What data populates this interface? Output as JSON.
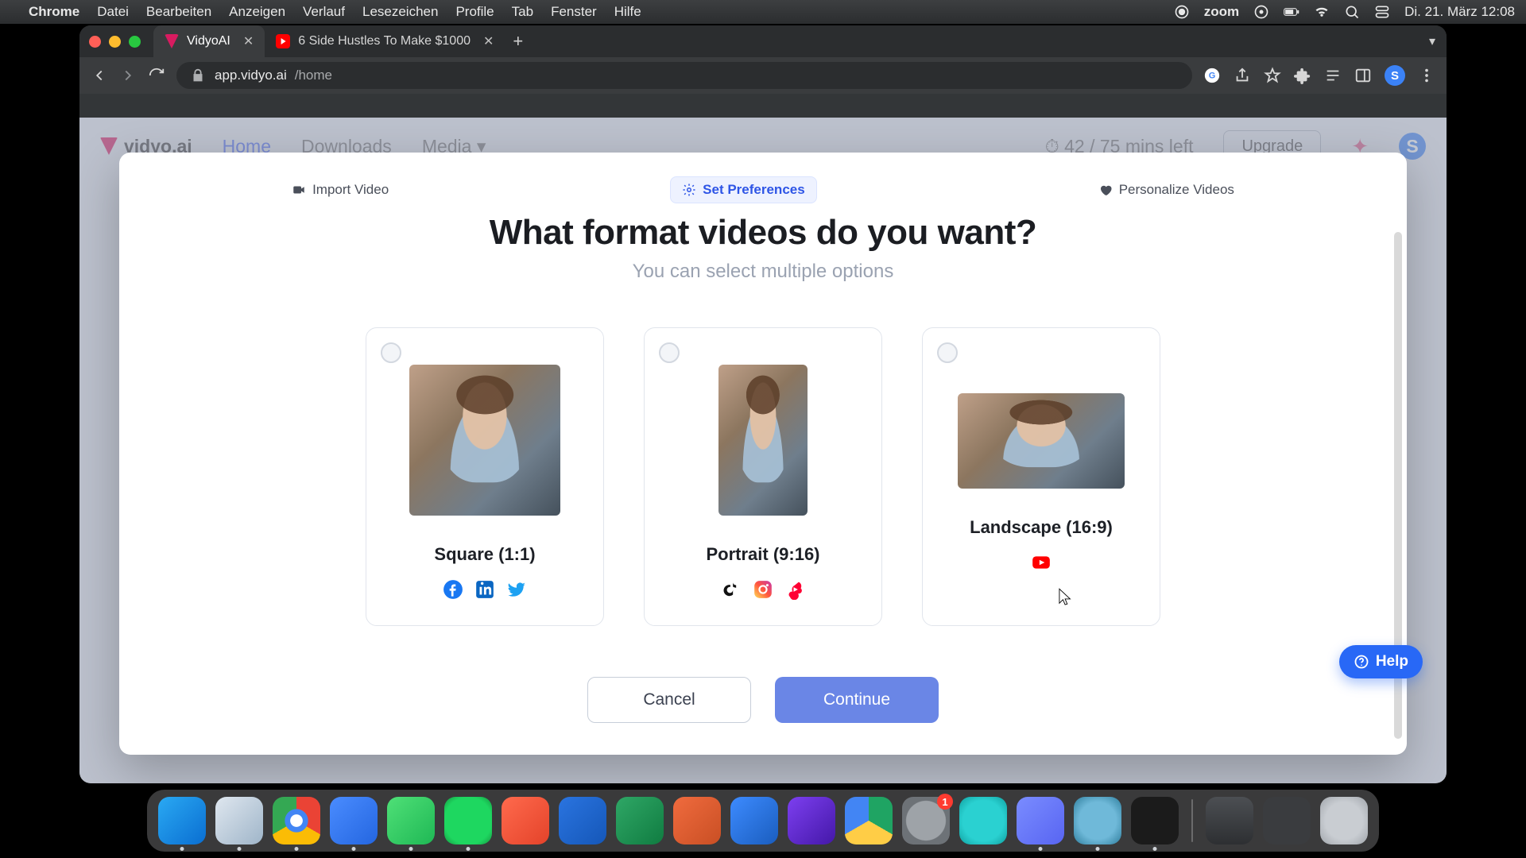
{
  "menubar": {
    "app": "Chrome",
    "items": [
      "Datei",
      "Bearbeiten",
      "Anzeigen",
      "Verlauf",
      "Lesezeichen",
      "Profile",
      "Tab",
      "Fenster",
      "Hilfe"
    ],
    "zoom": "zoom",
    "datetime": "Di. 21. März  12:08"
  },
  "tabs": [
    {
      "title": "VidyoAI",
      "active": true
    },
    {
      "title": "6 Side Hustles To Make $1000",
      "active": false
    }
  ],
  "address": {
    "host": "app.vidyo.ai",
    "path": "/home"
  },
  "toolbar": {
    "avatar_initial": "S"
  },
  "background_header": {
    "brand": "vidyo.ai",
    "nav": {
      "home": "Home",
      "downloads": "Downloads",
      "media": "Media"
    },
    "mins_left": "42 / 75 mins left",
    "upgrade": "Upgrade",
    "avatar_initial": "S"
  },
  "modal": {
    "steps": [
      {
        "label": "Import Video",
        "active": false
      },
      {
        "label": "Set Preferences",
        "active": true
      },
      {
        "label": "Personalize Videos",
        "active": false
      }
    ],
    "title": "What format videos do you want?",
    "subtitle": "You can select multiple options",
    "cards": [
      {
        "label": "Square (1:1)",
        "thumb": "sq",
        "socials": [
          "facebook",
          "linkedin",
          "twitter"
        ]
      },
      {
        "label": "Portrait (9:16)",
        "thumb": "pt",
        "socials": [
          "tiktok",
          "instagram",
          "ytshorts"
        ]
      },
      {
        "label": "Landscape (16:9)",
        "thumb": "ls",
        "socials": [
          "youtube"
        ]
      }
    ],
    "buttons": {
      "cancel": "Cancel",
      "continue": "Continue"
    },
    "help": "Help"
  },
  "dock": {
    "apps": [
      {
        "name": "finder",
        "bg": "linear-gradient(135deg,#2aa9f3,#0a6ed1)",
        "running": true
      },
      {
        "name": "safari",
        "bg": "linear-gradient(135deg,#dfe7ef,#9fb5c9)",
        "running": true
      },
      {
        "name": "chrome",
        "bg": "radial-gradient(circle at 50% 50%, #fff 0 18%, #4285f4 19% 34%, transparent 35%), conic-gradient(#ea4335 0 120deg,#fbbc05 120deg 240deg,#34a853 240deg 360deg)",
        "running": true
      },
      {
        "name": "zoom",
        "bg": "linear-gradient(135deg,#4a8cff,#2466e0)",
        "running": true
      },
      {
        "name": "whatsapp",
        "bg": "linear-gradient(135deg,#4fe077,#1fb855)",
        "running": true
      },
      {
        "name": "spotify",
        "bg": "radial-gradient(circle,#1ed760 0 70%, #14933f 100%)",
        "running": true
      },
      {
        "name": "todoist",
        "bg": "linear-gradient(135deg,#ff6a4d,#e4432a)",
        "running": false
      },
      {
        "name": "trello",
        "bg": "linear-gradient(135deg,#2a74e0,#1557b8)",
        "running": false
      },
      {
        "name": "excel",
        "bg": "linear-gradient(135deg,#2fa766,#107c41)",
        "running": false
      },
      {
        "name": "powerpoint",
        "bg": "linear-gradient(135deg,#f06b3e,#c94f24)",
        "running": false
      },
      {
        "name": "word",
        "bg": "linear-gradient(135deg,#3d8bff,#1a5dbe)",
        "running": false
      },
      {
        "name": "imovie",
        "bg": "linear-gradient(135deg,#7d3ff0,#4418a8)",
        "running": false
      },
      {
        "name": "drive",
        "bg": "conic-gradient(#1fa463 0 120deg,#ffcd46 120deg 240deg,#4285f4 240deg 360deg)",
        "running": false
      },
      {
        "name": "settings",
        "bg": "radial-gradient(circle,#9ea3a8 0 58%, #6d7277 60% 100%)",
        "running": false,
        "badge": "1"
      },
      {
        "name": "siri",
        "bg": "radial-gradient(circle,#2ad1d1 0 60%, #0f9e9e 100%)",
        "running": false
      },
      {
        "name": "discord",
        "bg": "linear-gradient(135deg,#7a8cff,#5865f2)",
        "running": true
      },
      {
        "name": "quicktime",
        "bg": "radial-gradient(circle,#6fb9d9 0 55%, #2e7d9c 100%)",
        "running": true
      },
      {
        "name": "audio",
        "bg": "#1b1b1b",
        "running": true
      }
    ],
    "right": [
      {
        "name": "calculator",
        "bg": "linear-gradient(#4c4f53,#2d2f32)"
      },
      {
        "name": "mission",
        "bg": "#3a3c3f"
      },
      {
        "name": "trash",
        "bg": "radial-gradient(circle,#c9cdd2 0 55%, #9fa4aa 100%)"
      }
    ]
  }
}
